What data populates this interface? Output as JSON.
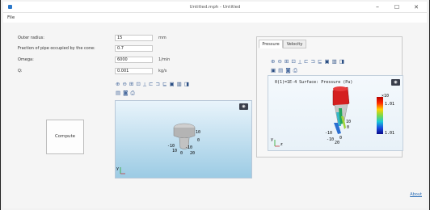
{
  "window": {
    "title": "Untitled.mph - Untitled",
    "minimize": "–",
    "maximize": "☐",
    "close": "✕"
  },
  "menu": {
    "file": "File"
  },
  "inputs": {
    "outer_radius": {
      "label": "Outer radius:",
      "value": "15",
      "unit": "mm"
    },
    "fraction": {
      "label": "Fraction of pipe occupied by the cone:",
      "value": "0.7"
    },
    "omega": {
      "label": "Omega:",
      "value": "6000",
      "unit": "1/min"
    },
    "q": {
      "label": "Q:",
      "value": "0.001",
      "unit": "kg/s"
    }
  },
  "compute_button": "Compute",
  "tabs": {
    "pressure": "Pressure",
    "velocity": "Velocity"
  },
  "plot": {
    "title": "0(1)=1E-4  Surface: Pressure (Pa)",
    "colorbar_exponent": "×10",
    "colorbar_max": "1.01",
    "colorbar_min": "1.01",
    "axis_y": "y",
    "axis_z": "z",
    "axis_labels": [
      "10",
      "-10",
      "0",
      "-10",
      "0",
      "20"
    ]
  },
  "geometry_plot": {
    "axis_y": "y",
    "axis_labels": [
      "10",
      "-10",
      "0",
      "10",
      "-10",
      "0",
      "20"
    ]
  },
  "about_link": "About",
  "toolbar_icons": [
    "zoom-in-icon",
    "zoom-out-icon",
    "zoom-box-icon",
    "zoom-extents-icon",
    "axis-icon",
    "view-xy-icon",
    "view-yz-icon",
    "view-zx-icon",
    "view-3d-icon",
    "render-icon",
    "wireframe-icon",
    "transparency-icon",
    "camera-icon",
    "print-icon"
  ]
}
